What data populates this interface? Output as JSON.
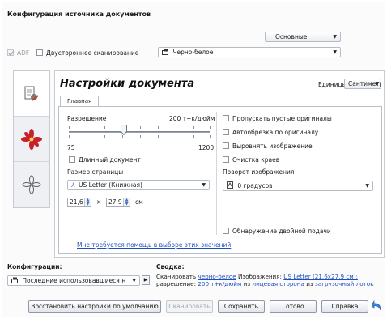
{
  "header": {
    "title": "Конфигурация источника документов"
  },
  "mode_dropdown": {
    "value": "Основные"
  },
  "adf": {
    "label": "ADF",
    "checked": true,
    "disabled": true
  },
  "duplex": {
    "label": "Двустороннее сканирование",
    "checked": false
  },
  "color_dropdown": {
    "value": "Черно-белое",
    "icon": "color-mode-icon"
  },
  "sidebar": {
    "tabs": [
      {
        "name": "document-settings",
        "icon": "document-settings-icon",
        "active": true
      },
      {
        "name": "image-settings",
        "icon": "red-flower-icon",
        "active": false
      },
      {
        "name": "advanced-settings",
        "icon": "sketch-flower-icon",
        "active": false
      }
    ]
  },
  "panel": {
    "title": "Настройки документа",
    "units_label": "Единицы",
    "units_value": "Сантиметры",
    "tab": "Главная",
    "resolution": {
      "label": "Разрешение",
      "value": "200 т+к/дюйм",
      "min": "75",
      "max": "1200",
      "current": 200
    },
    "long_document": {
      "label": "Длинный документ",
      "checked": false
    },
    "page_size": {
      "label": "Размер страницы",
      "value": "US Letter (Книжная)",
      "width": "21,6",
      "height": "27,9",
      "times": "×",
      "unit": "см"
    },
    "help_link": "Мне требуется помощь в выборе этих значений",
    "options": [
      {
        "label": "Пропускать пустые оригиналы",
        "checked": false
      },
      {
        "label": "Автообрезка по оригиналу",
        "checked": false
      },
      {
        "label": "Выровнять изображение",
        "checked": false
      },
      {
        "label": "Очистка краев",
        "checked": false
      }
    ],
    "rotation": {
      "label": "Поворот изображения",
      "value": "0 градусов"
    },
    "double_feed": {
      "label": "Обнаружение двойной подачи",
      "checked": false
    }
  },
  "footer": {
    "config_label": "Конфигурации:",
    "config_value": "Последние использовавшиеся н",
    "summary_label": "Сводка:",
    "summary": {
      "line1_prefix": "Сканировать",
      "line1_link1": "черно-белое",
      "line1_mid": "Изображения:",
      "line1_link2": "US Letter (21,6х27,9 см);",
      "line2_prefix": "разрешение:",
      "line2_link1": "200 т+к/дюйм",
      "line2_mid1": "из",
      "line2_link2": "лицевая сторона",
      "line2_mid2": "из",
      "line2_link3": "загрузочный лоток"
    },
    "buttons": {
      "restore": "Восстановить настройки по умолчанию",
      "scan": "Сканировать",
      "save": "Сохранить",
      "done": "Готово",
      "help": "Справка"
    }
  },
  "colors": {
    "link": "#1f4fbf",
    "panel_border": "#c7ccd3",
    "accent": "#3d6fb4"
  }
}
